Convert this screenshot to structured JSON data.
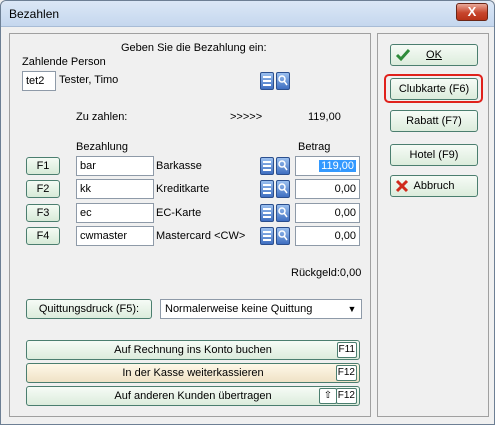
{
  "window": {
    "title": "Bezahlen",
    "close_symbol": "X"
  },
  "header": {
    "heading": "Geben Sie die Bezahlung ein:",
    "payer_label": "Zahlende Person",
    "payer_code": "tet2",
    "payer_name": "Tester, Timo"
  },
  "amount_due": {
    "label": "Zu zahlen:",
    "arrows": ">>>>>",
    "value": "119,00"
  },
  "columns": {
    "payment": "Bezahlung",
    "amount": "Betrag"
  },
  "payments": [
    {
      "key": "F1",
      "code": "bar",
      "name": "Barkasse",
      "amount": "119,00",
      "selected": true
    },
    {
      "key": "F2",
      "code": "kk",
      "name": "Kreditkarte",
      "amount": "0,00"
    },
    {
      "key": "F3",
      "code": "ec",
      "name": "EC-Karte",
      "amount": "0,00"
    },
    {
      "key": "F4",
      "code": "cwmaster",
      "name": "Mastercard <CW>",
      "amount": "0,00"
    }
  ],
  "change": "Rückgeld:0,00",
  "receipt": {
    "button": "Quittungsdruck (F5):",
    "selected_option": "Normalerweise keine Quittung"
  },
  "actions": [
    {
      "label": "Auf Rechnung ins Konto buchen",
      "key": "F11"
    },
    {
      "label": "In der Kasse weiterkassieren",
      "key": "F12"
    },
    {
      "label": "Auf anderen Kunden übertragen",
      "key": "F12"
    }
  ],
  "side_buttons": {
    "ok": "OK",
    "clubkarte": "Clubkarte (F6)",
    "rabatt": "Rabatt (F7)",
    "hotel": "Hotel (F9)",
    "abbruch": "Abbruch"
  },
  "icons": [
    "list-icon",
    "search-icon",
    "check-icon",
    "cancel-icon",
    "shift-key-icon"
  ],
  "colors": {
    "selection": "#3399ff",
    "highlight": "#e0211c",
    "button_border": "#4b7e6f"
  }
}
